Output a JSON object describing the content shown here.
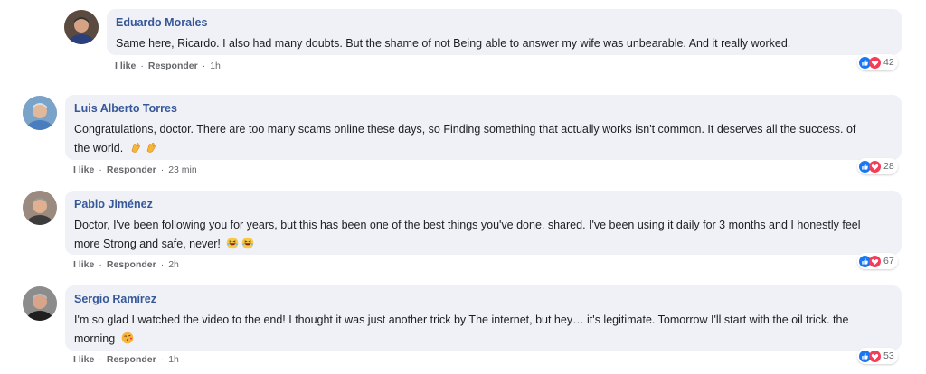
{
  "comments": [
    {
      "author": "Eduardo Morales",
      "text": "Same here, Ricardo. I also had many doubts. But the shame of not Being able to answer my wife was unbearable. And it really worked.",
      "text_line2": "",
      "emojis": [],
      "like_label": "I like",
      "reply_label": "Responder",
      "time": "1h",
      "reactions": [
        "like-icon",
        "love-icon"
      ],
      "count": "42",
      "avatar": {
        "bg": "#5a4a40",
        "skin": "#d5a283",
        "shirt": "#2b3f7a",
        "hair": "#333333"
      }
    },
    {
      "author": "Luis Alberto Torres",
      "text": "Congratulations, doctor. There are too many scams online these days, so Finding something that actually works isn't common. It deserves all the success. of",
      "text_line2": "the world.",
      "emojis": [
        "clapping-hands-emoji",
        "clapping-hands-emoji"
      ],
      "like_label": "I like",
      "reply_label": "Responder",
      "time": "23 min",
      "reactions": [
        "like-icon",
        "love-icon"
      ],
      "count": "28",
      "avatar": {
        "bg": "#7aa3c9",
        "skin": "#e2b89a",
        "shirt": "#4a7dbf",
        "hair": "#dddddd"
      }
    },
    {
      "author": "Pablo Jiménez",
      "text": "Doctor, I've been following you for years, but this has been one of the best things you've done. shared. I've been using it daily for 3 months and I honestly feel",
      "text_line2": "more Strong and safe, never!",
      "emojis": [
        "laughing-emoji",
        "laughing-emoji"
      ],
      "like_label": "I like",
      "reply_label": "Responder",
      "time": "2h",
      "reactions": [
        "like-icon",
        "love-icon"
      ],
      "count": "67",
      "avatar": {
        "bg": "#9a8a80",
        "skin": "#e0b090",
        "shirt": "#3c3c3c",
        "hair": "#9a9a9a"
      }
    },
    {
      "author": "Sergio Ramírez",
      "text": "I'm so glad I watched the video to the end! I thought it was just another trick by The internet, but hey… it's legitimate. Tomorrow I'll start with the oil trick. the",
      "text_line2": "morning",
      "emojis": [
        "kissing-face-emoji"
      ],
      "like_label": "I like",
      "reply_label": "Responder",
      "time": "1h",
      "reactions": [
        "like-icon",
        "love-icon"
      ],
      "count": "53",
      "avatar": {
        "bg": "#8c8c8c",
        "skin": "#d9a58a",
        "shirt": "#1f1f1f",
        "hair": "#bbbbbb"
      }
    }
  ],
  "colors": {
    "author": "#365899",
    "bubble": "#eff1f6",
    "like_blue": "#1877f2",
    "love_red": "#f33e58",
    "meta_gray": "#65676b"
  }
}
